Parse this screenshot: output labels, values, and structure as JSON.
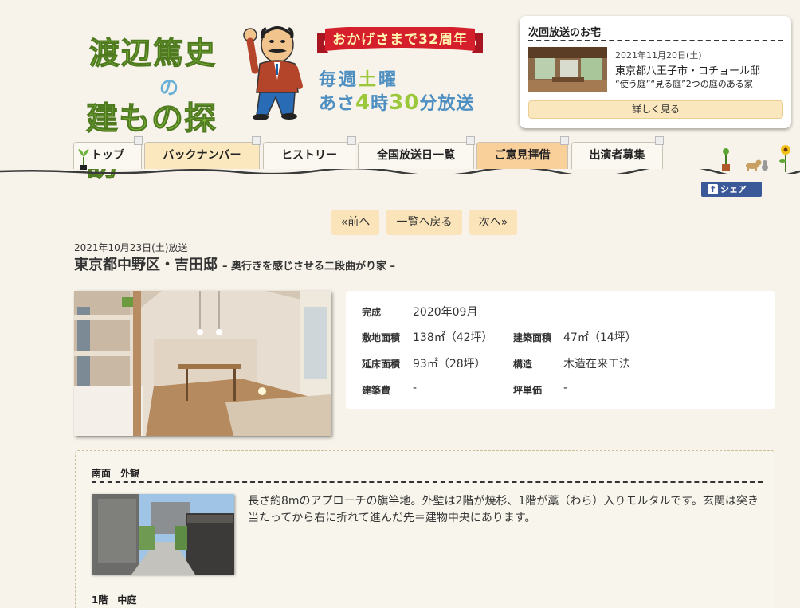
{
  "header": {
    "logo_line1": "渡辺篤史",
    "logo_line2": "の",
    "logo_line3": "建もの探訪",
    "anniversary": "おかげさまで32周年",
    "schedule_line1_pre": "毎週",
    "schedule_line1_hl": "土",
    "schedule_line1_post": "曜",
    "schedule_line2_pre": "あさ",
    "schedule_line2_hl1": "4",
    "schedule_line2_mid": "時",
    "schedule_line2_hl2": "30",
    "schedule_line2_post": "分放送"
  },
  "next_broadcast": {
    "title": "次回放送のお宅",
    "date": "2021年11月20日(土)",
    "house": "東京都八王子市・コチョール邸",
    "subtitle": "“使う庭”“見る庭”2つの庭のある家",
    "button": "詳しく見る"
  },
  "nav": {
    "items": [
      {
        "label": "トップ"
      },
      {
        "label": "バックナンバー"
      },
      {
        "label": "ヒストリー"
      },
      {
        "label": "全国放送日一覧"
      },
      {
        "label": "ご意見拝借"
      },
      {
        "label": "出演者募集"
      }
    ]
  },
  "share": {
    "label": "シェア",
    "icon": "f"
  },
  "pager": {
    "prev": "«前へ",
    "list": "一覧へ戻る",
    "next": "次へ»"
  },
  "episode": {
    "air_date": "2021年10月23日(土)放送",
    "title": "東京都中野区・吉田邸",
    "subtitle": "– 奥行きを感じさせる二段曲がり家 –"
  },
  "spec": {
    "completion_label": "完成",
    "completion_value": "2020年09月",
    "site_area_label": "敷地面積",
    "site_area_value": "138㎡（42坪）",
    "building_area_label": "建築面積",
    "building_area_value": "47㎡（14坪）",
    "floor_area_label": "延床面積",
    "floor_area_value": "93㎡（28坪）",
    "structure_label": "構造",
    "structure_value": "木造在来工法",
    "cost_label": "建築費",
    "cost_value": "-",
    "tsubo_price_label": "坪単価",
    "tsubo_price_value": "-"
  },
  "sections": [
    {
      "title": "南面　外観",
      "text": "長さ約8mのアプローチの旗竿地。外壁は2階が焼杉、1階が藁（わら）入りモルタルです。玄関は突き当たってから右に折れて進んだ先＝建物中央にあります。"
    },
    {
      "title": "1階　中庭"
    }
  ]
}
